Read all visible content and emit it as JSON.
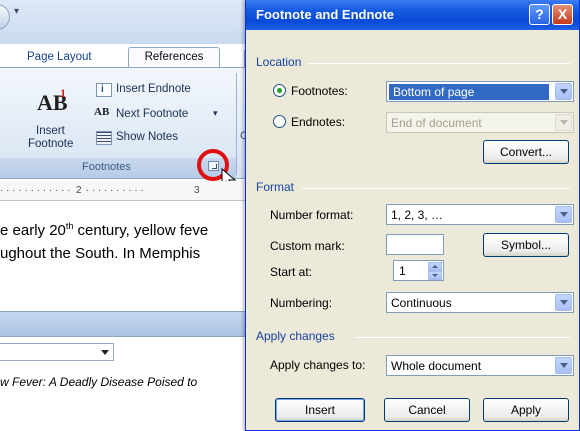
{
  "word": {
    "qat_arrow": "▾",
    "tabs": {
      "page_layout": "Page Layout",
      "references": "References"
    },
    "ribbon": {
      "insert_footnote_line1": "Insert",
      "insert_footnote_line2": "Footnote",
      "ab_text": "AB",
      "ab_sup": "1",
      "next_icon_text": "AB",
      "insert_endnote": "Insert Endnote",
      "next_footnote": "Next Footnote",
      "next_caret": "▾",
      "show_notes": "Show Notes",
      "group_label": "Footnotes",
      "next_group_char": "C"
    },
    "ruler": {
      "mark_2": "2",
      "mark_3": "3"
    },
    "document": {
      "line1_pre": "e early 20",
      "line1_sup": "th",
      "line1_post": " century, yellow feve",
      "line2": "ughout the South.  In Memphis"
    },
    "notes": {
      "text": "w Fever: A Deadly Disease Poised to"
    }
  },
  "dialog": {
    "title": "Footnote and Endnote",
    "help_glyph": "?",
    "close_glyph": "X",
    "location": {
      "section_title": "Location",
      "footnotes_label": "Footnotes:",
      "footnotes_value": "Bottom of page",
      "footnotes_selected": true,
      "endnotes_label": "Endnotes:",
      "endnotes_value": "End of document",
      "convert_button": "Convert..."
    },
    "format": {
      "section_title": "Format",
      "number_format_label": "Number format:",
      "number_format_value": "1, 2, 3, …",
      "custom_mark_label": "Custom mark:",
      "custom_mark_value": "",
      "symbol_button": "Symbol...",
      "start_at_label": "Start at:",
      "start_at_value": "1",
      "numbering_label": "Numbering:",
      "numbering_value": "Continuous"
    },
    "apply": {
      "section_title": "Apply changes",
      "apply_to_label": "Apply changes to:",
      "apply_to_value": "Whole document"
    },
    "buttons": {
      "insert": "Insert",
      "cancel": "Cancel",
      "apply": "Apply"
    }
  },
  "colors": {
    "dialog_title_bar": "#0a4ad7",
    "highlight_circle": "#e01010",
    "section_title": "#1542a3"
  }
}
